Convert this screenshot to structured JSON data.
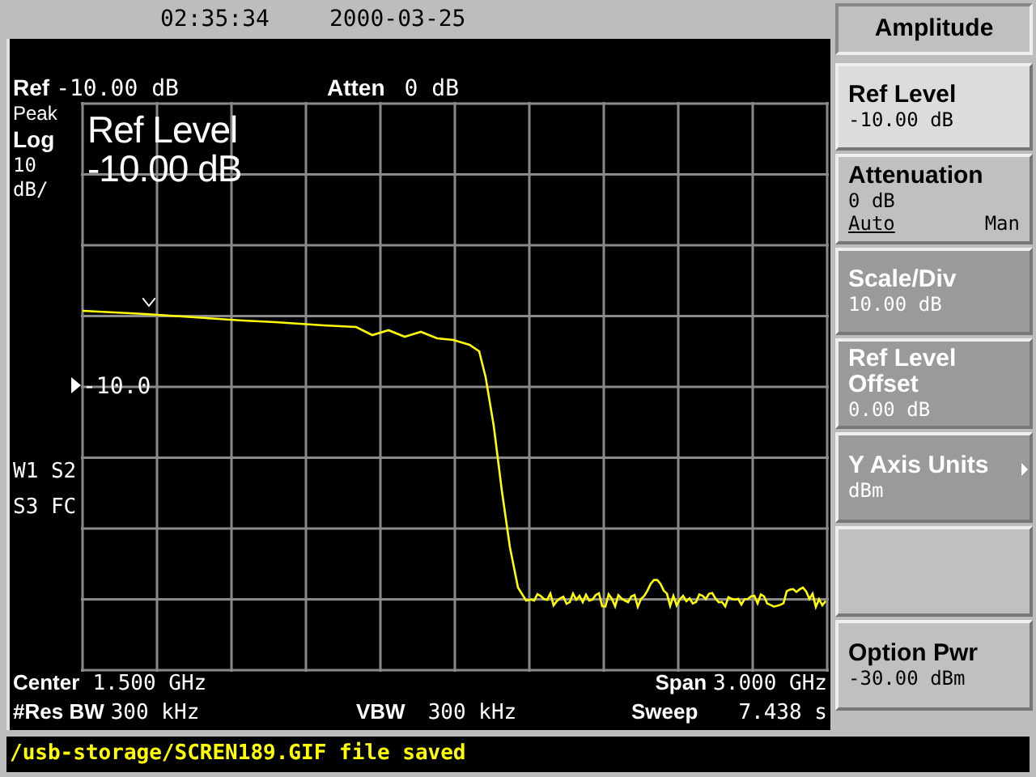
{
  "top_bar": {
    "time": "02:35:34",
    "date": "2000-03-25"
  },
  "display": {
    "ref_label": "Ref",
    "ref_value": "-10.00 dB",
    "atten_label": "Atten",
    "atten_value": "0 dB",
    "detector": "Peak",
    "scale_type": "Log",
    "scale_value": "10",
    "scale_unit": "dB/",
    "active_function": {
      "label": "Ref Level",
      "value": "-10.00 dB"
    },
    "display_line": "-10.0",
    "trace_flags": [
      "W1 S2",
      "S3 FC"
    ],
    "center_label": "Center",
    "center_value": "1.500 GHz",
    "span_label": "Span",
    "span_value": "3.000 GHz",
    "rbw_label": "#Res BW",
    "rbw_value": "300 kHz",
    "vbw_label": "VBW",
    "vbw_value": "300 kHz",
    "sweep_label": "Sweep",
    "sweep_value": "7.438 s"
  },
  "menu": {
    "title": "Amplitude",
    "softkeys": [
      {
        "kind": "value",
        "label": "Ref Level",
        "value": "-10.00 dB",
        "selected": true,
        "disabled": false
      },
      {
        "kind": "toggle",
        "label": "Attenuation",
        "value": "0 dB",
        "selected": false,
        "disabled": false,
        "options": [
          {
            "label": "Auto",
            "selected": true
          },
          {
            "label": "Man",
            "selected": false
          }
        ]
      },
      {
        "kind": "value",
        "label": "Scale/Div",
        "value": "10.00 dB",
        "selected": false,
        "disabled": true
      },
      {
        "kind": "value",
        "label": "Ref Level Offset",
        "value": "0.00 dB",
        "selected": false,
        "disabled": true
      },
      {
        "kind": "submenu",
        "label": "Y Axis Units",
        "value": "dBm",
        "selected": false,
        "disabled": true
      },
      {
        "kind": "blank",
        "selected": false
      },
      {
        "kind": "value",
        "label": "Option Pwr",
        "value": "-30.00 dBm",
        "selected": false,
        "disabled": false
      }
    ]
  },
  "status_line": "/usb-storage/SCREN189.GIF file saved"
}
